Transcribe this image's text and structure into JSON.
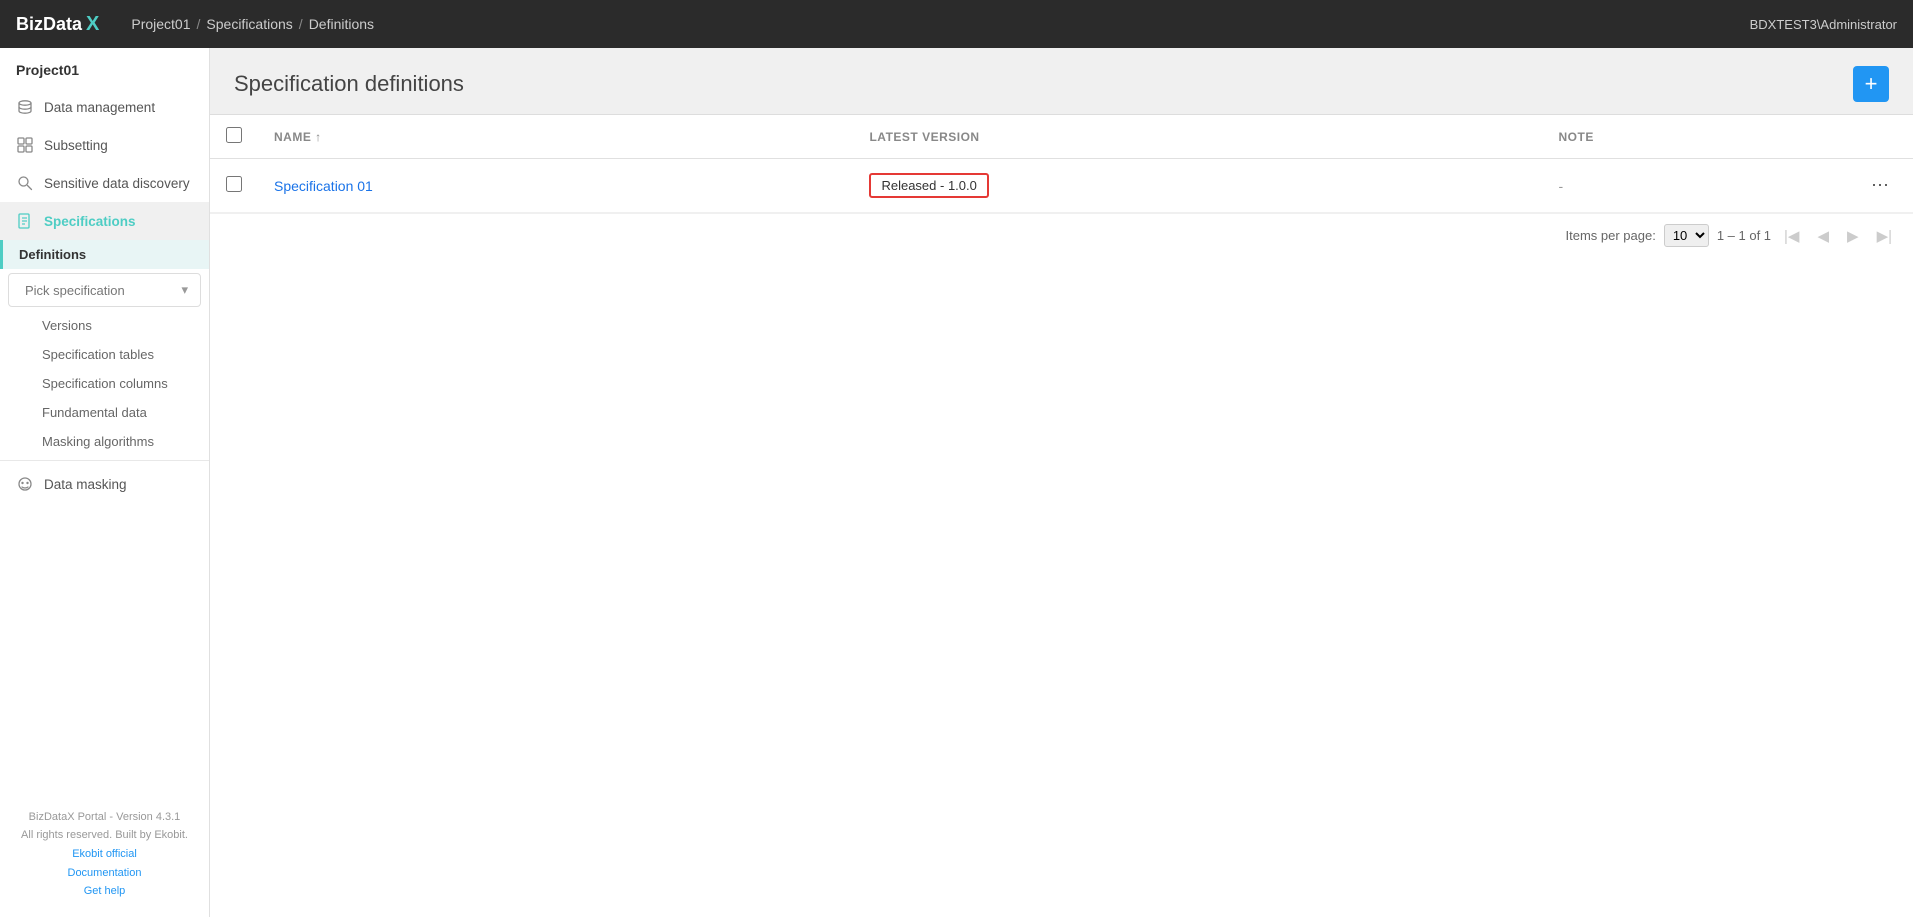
{
  "topnav": {
    "logo_text": "BizData",
    "logo_x": "X",
    "breadcrumb": [
      {
        "label": "Project01",
        "sep": false
      },
      {
        "label": "/",
        "sep": true
      },
      {
        "label": "Specifications",
        "sep": false
      },
      {
        "label": "/",
        "sep": true
      },
      {
        "label": "Definitions",
        "sep": false
      }
    ],
    "user": "BDXTEST3\\Administrator"
  },
  "sidebar": {
    "project_label": "Project01",
    "items": [
      {
        "id": "data-management",
        "label": "Data management",
        "icon": "database"
      },
      {
        "id": "subsetting",
        "label": "Subsetting",
        "icon": "puzzle"
      },
      {
        "id": "sensitive-data",
        "label": "Sensitive data discovery",
        "icon": "search"
      },
      {
        "id": "specifications",
        "label": "Specifications",
        "icon": "book",
        "active": true
      }
    ],
    "definitions_label": "Definitions",
    "pick_spec_placeholder": "Pick specification",
    "sub_items": [
      {
        "id": "versions",
        "label": "Versions"
      },
      {
        "id": "spec-tables",
        "label": "Specification tables"
      },
      {
        "id": "spec-columns",
        "label": "Specification columns"
      },
      {
        "id": "fundamental-data",
        "label": "Fundamental data"
      },
      {
        "id": "masking-alg",
        "label": "Masking algorithms"
      }
    ],
    "data_masking_label": "Data masking",
    "footer": {
      "version_text": "BizDataX Portal - Version 4.3.1",
      "rights_text": "All rights reserved. Built by Ekobit.",
      "links": [
        {
          "label": "Ekobit official",
          "href": "#"
        },
        {
          "label": "Documentation",
          "href": "#"
        },
        {
          "label": "Get help",
          "href": "#"
        }
      ]
    }
  },
  "main": {
    "title": "Specification definitions",
    "add_button_label": "+",
    "table": {
      "columns": [
        {
          "id": "check",
          "label": ""
        },
        {
          "id": "name",
          "label": "NAME ↑"
        },
        {
          "id": "latest_version",
          "label": "LATEST VERSION"
        },
        {
          "id": "note",
          "label": "NOTE"
        }
      ],
      "rows": [
        {
          "id": 1,
          "name": "Specification 01",
          "latest_version": "Released - 1.0.0",
          "note": "-"
        }
      ]
    },
    "pagination": {
      "items_per_page_label": "Items per page:",
      "items_per_page_value": "10",
      "range_text": "1 – 1 of 1"
    }
  }
}
